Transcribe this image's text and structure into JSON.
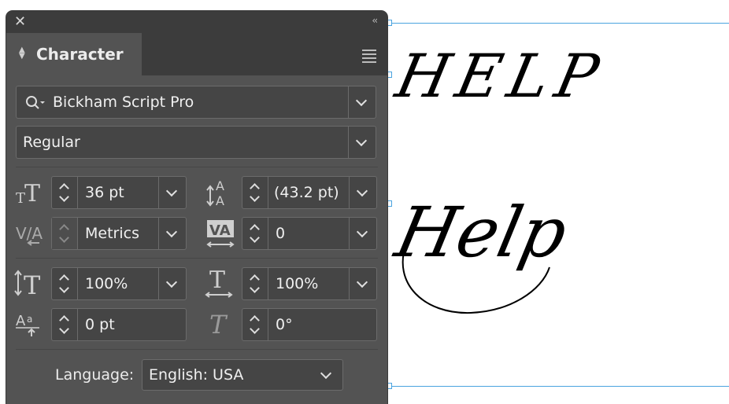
{
  "panel": {
    "tab_title": "Character",
    "font_family": "Bickham Script Pro",
    "font_style": "Regular",
    "font_size": "36 pt",
    "leading": "(43.2 pt)",
    "kerning": "Metrics",
    "tracking": "0",
    "vertical_scale": "100%",
    "horizontal_scale": "100%",
    "baseline_shift": "0 pt",
    "skew": "0°",
    "language_label": "Language:",
    "language": "English: USA"
  },
  "canvas": {
    "text_upper": "HELP",
    "text_mixed": "Help"
  },
  "colors": {
    "panel_bg": "#535353",
    "panel_header": "#3c3c3c",
    "field_bg": "#454545",
    "guide": "#4aa3df"
  }
}
